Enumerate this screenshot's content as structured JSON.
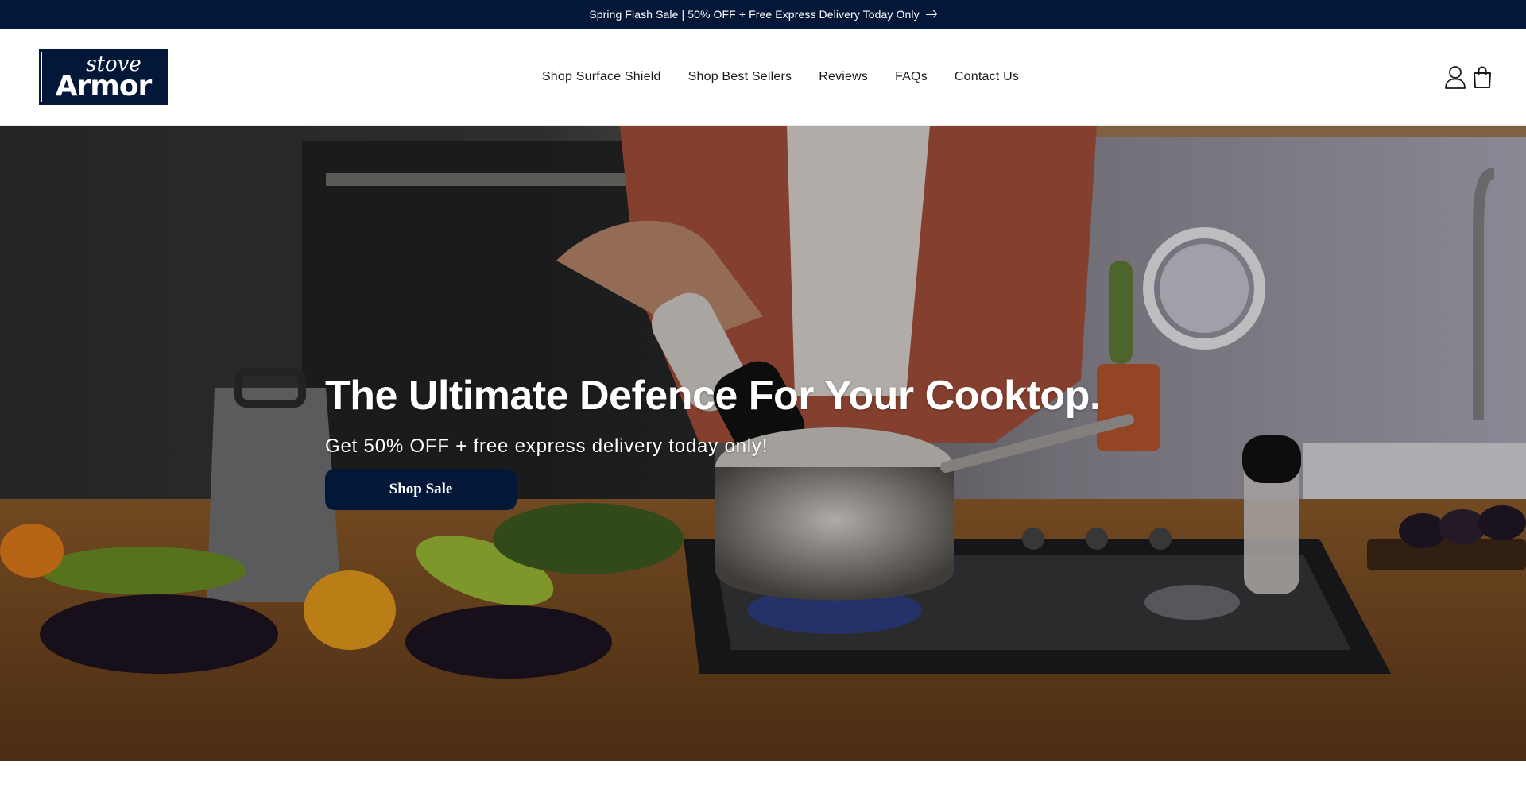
{
  "announcement": {
    "text": "Spring Flash Sale | 50% OFF + Free Express Delivery Today Only",
    "icon": "arrow-right-icon"
  },
  "header": {
    "logo": {
      "line1": "stove",
      "line2": "Armor"
    },
    "nav": [
      {
        "label": "Shop Surface Shield"
      },
      {
        "label": "Shop Best Sellers"
      },
      {
        "label": "Reviews"
      },
      {
        "label": "FAQs"
      },
      {
        "label": "Contact Us"
      }
    ],
    "icons": [
      "account-icon",
      "cart-icon"
    ]
  },
  "hero": {
    "title": "The Ultimate Defence For Your Cooktop.",
    "subtitle": "Get 50% OFF + free express delivery today only!",
    "button_label": "Shop Sale"
  },
  "colors": {
    "brand_navy": "#031838",
    "text_dark": "#1a1a1a",
    "white": "#ffffff"
  }
}
